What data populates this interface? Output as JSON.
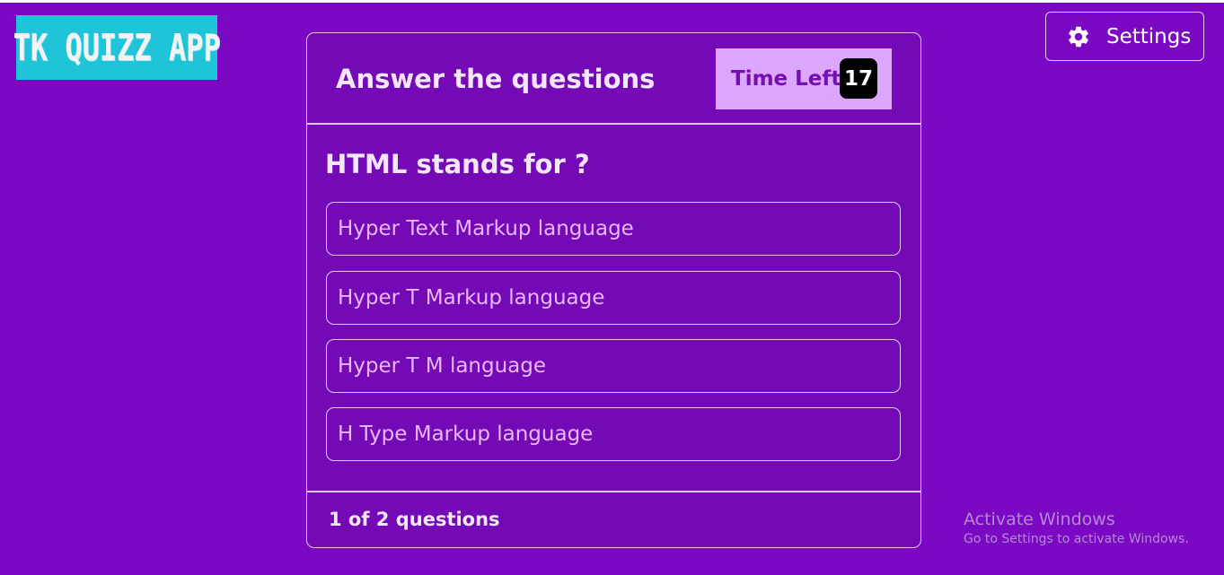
{
  "app": {
    "logo_text": "TK QUIZZ APP"
  },
  "header": {
    "settings_label": "Settings",
    "settings_icon": "gear-icon"
  },
  "quiz": {
    "title": "Answer the questions",
    "timer_label": "Time Left",
    "time_left": "17",
    "question": "HTML stands for ?",
    "options": [
      "Hyper Text Markup language",
      "Hyper T Markup language",
      "Hyper T M language",
      "H Type Markup language"
    ],
    "progress": "1 of 2 questions"
  },
  "watermark": {
    "line1": "Activate Windows",
    "line2": "Go to Settings to activate Windows."
  },
  "colors": {
    "background": "#7b08c2",
    "card": "#730ab6",
    "accent": "#dda7ff",
    "logo_bg": "#1fc4d8"
  }
}
